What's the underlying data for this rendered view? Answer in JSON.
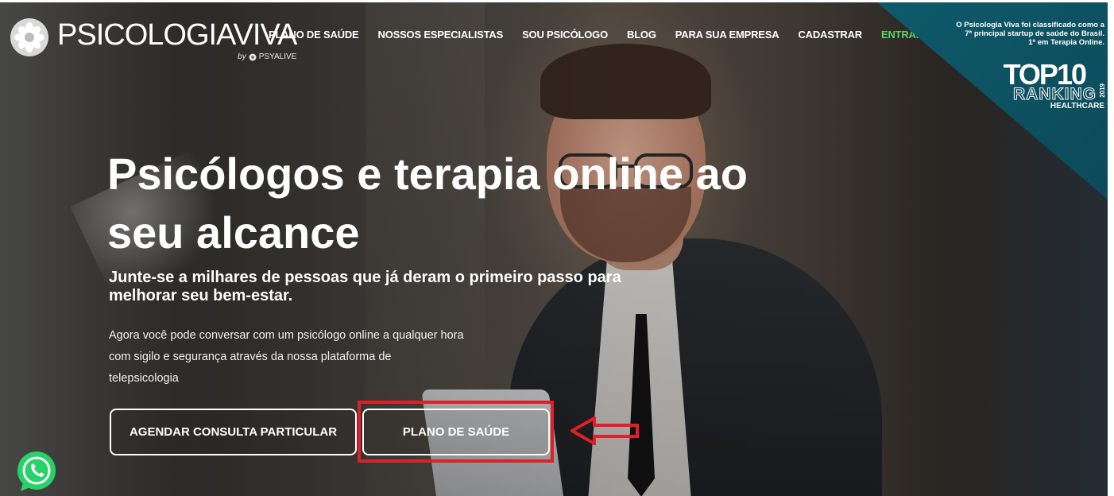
{
  "header": {
    "logo_text": "PSICOLOGIAVIVA",
    "logo_sub_by": "by",
    "logo_sub_brand": "PSYALIVE",
    "nav": [
      {
        "label": "PLANO DE SAÚDE"
      },
      {
        "label": "NOSSOS ESPECIALISTAS"
      },
      {
        "label": "SOU PSICÓLOGO"
      },
      {
        "label": "BLOG"
      },
      {
        "label": "PARA SUA EMPRESA"
      },
      {
        "label": "CADASTRAR"
      },
      {
        "label": "ENTRAR"
      }
    ]
  },
  "badge": {
    "line1": "O Psicologia Viva foi classificado como a",
    "line2": "7ª principal startup de saúde do Brasil.",
    "line3": "1ª em Terapia Online.",
    "top10": "TOP10",
    "ranking": "RANKING",
    "year": "2019",
    "category": "HEALTHCARE"
  },
  "hero": {
    "headline_line1": "Psicólogos e terapia online ao",
    "headline_line2": "seu alcance",
    "subheadline_line1": "Junte-se a milhares de pessoas que já deram o primeiro passo para",
    "subheadline_line2": "melhorar seu bem-estar.",
    "body_line1": "Agora você pode conversar com um psicólogo online a qualquer hora",
    "body_line2": "com sigilo e segurança através da nossa plataforma de",
    "body_line3": "telepsicologia",
    "btn_private": "AGENDAR CONSULTA PARTICULAR",
    "btn_plan": "PLANO DE SAÚDE"
  },
  "colors": {
    "accent_green": "#5bd36b",
    "badge_teal": "#0f5a6b",
    "highlight_red": "#e02029",
    "whatsapp_green": "#25d366"
  },
  "icons": {
    "logo": "flower-logo-icon",
    "psyalive": "psyalive-logo-icon",
    "whatsapp": "whatsapp-icon",
    "arrow": "left-arrow-annotation"
  }
}
